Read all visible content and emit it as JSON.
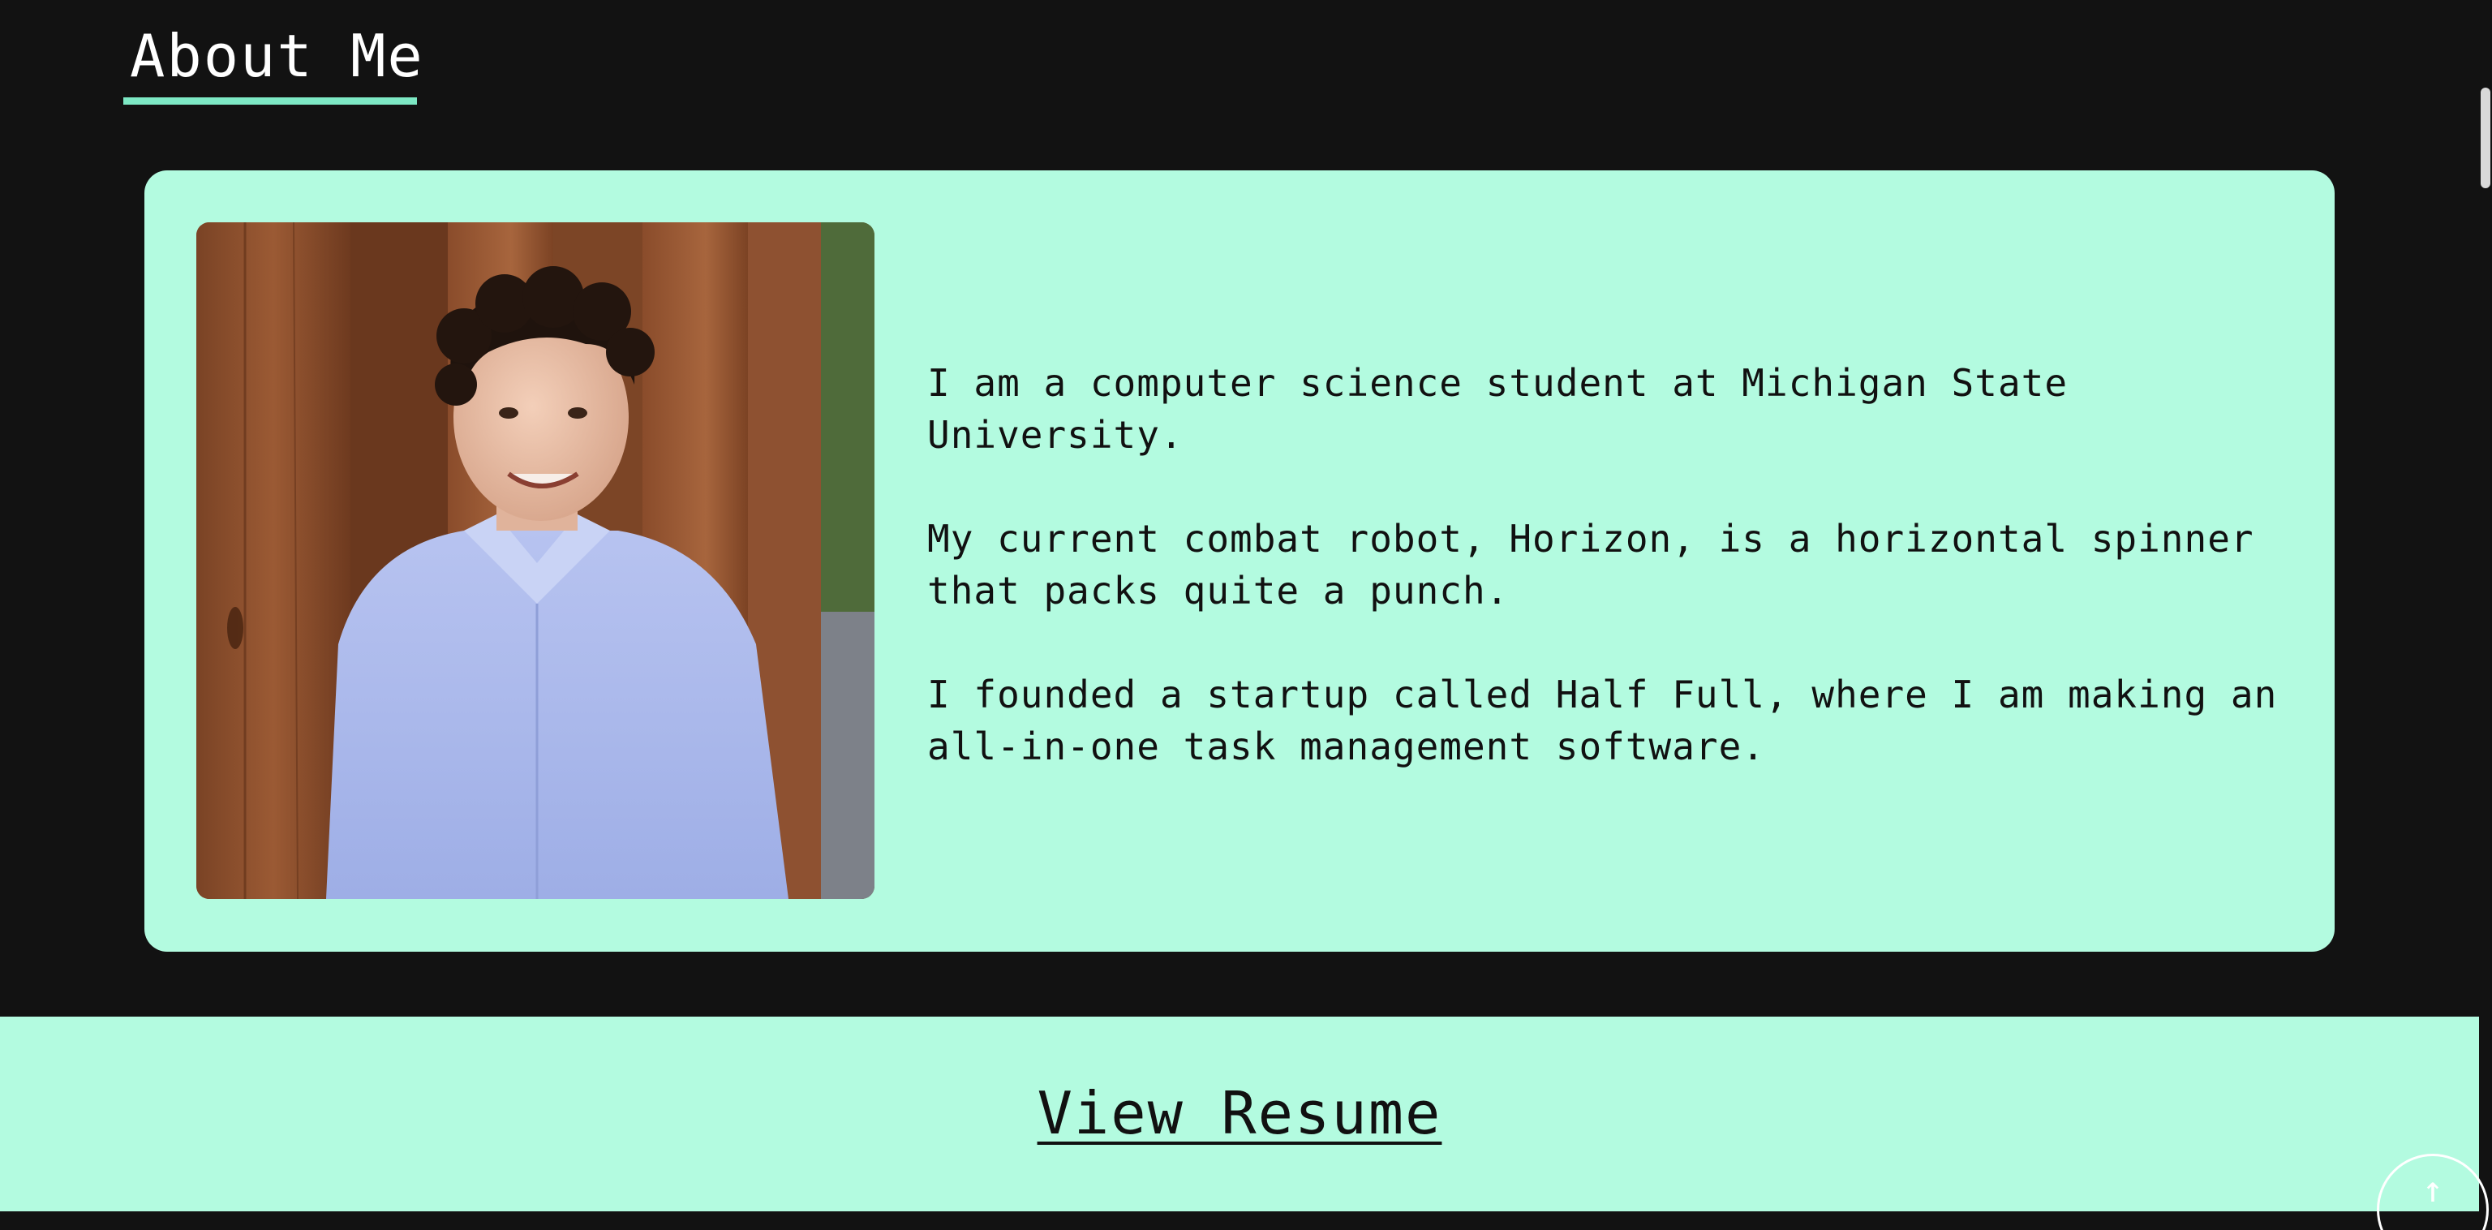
{
  "about": {
    "title": "About Me",
    "accent_color": "#7de8c4",
    "card_color": "#b3fbe0",
    "photo_alt": "Portrait photo",
    "paragraphs": [
      "I am a computer science student at Michigan State University.",
      "My current combat robot, Horizon, is a horizontal spinner that packs quite a punch.",
      "I founded a startup called Half Full, where I am making an all-in-one task management software."
    ]
  },
  "resume": {
    "label": "View Resume"
  },
  "controls": {
    "back_to_top_icon": "arrow-up-icon",
    "back_to_top_glyph": "↑"
  }
}
